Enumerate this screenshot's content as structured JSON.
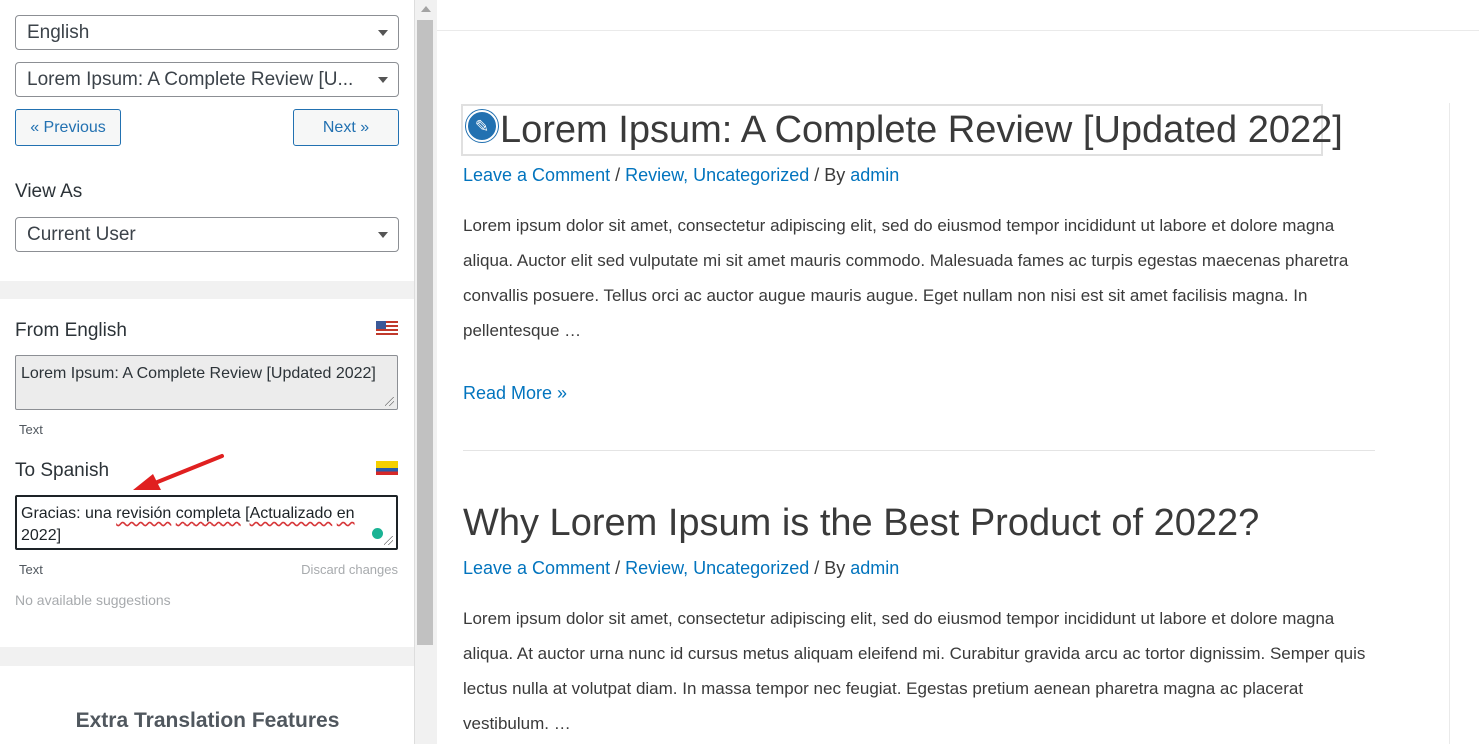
{
  "sidebar": {
    "language_select": "English",
    "string_select": "Lorem Ipsum: A Complete Review [U...",
    "prev_label": "« Previous",
    "next_label": "Next »",
    "view_as_label": "View As",
    "view_as_select": "Current User",
    "from_label": "From English",
    "from_text": "Lorem Ipsum: A Complete Review [Updated 2022]",
    "from_type": "Text",
    "to_label": "To Spanish",
    "to_text_part1": "Gracias: una ",
    "to_text_revision": "revisión",
    "to_text_space": " ",
    "to_text_completa": "completa",
    "to_text_part2": " [",
    "to_text_actualizado": "Actualizado",
    "to_text_part3": " ",
    "to_text_en": "en",
    "to_text_part4": " 2022]",
    "to_type": "Text",
    "discard_label": "Discard changes",
    "suggestions_text": "No available suggestions",
    "extra_title": "Extra Translation Features"
  },
  "posts": [
    {
      "title": "Lorem Ipsum: A Complete Review [Updated 2022]",
      "meta_comment": "Leave a Comment",
      "meta_sep1": " / ",
      "meta_cat1": "Review",
      "meta_comma": ", ",
      "meta_cat2": "Uncategorized",
      "meta_sep2": " / By ",
      "meta_author": "admin",
      "excerpt": "Lorem ipsum dolor sit amet, consectetur adipiscing elit, sed do eiusmod tempor incididunt ut labore et dolore magna aliqua. Auctor elit sed vulputate mi sit amet mauris commodo. Malesuada fames ac turpis egestas maecenas pharetra convallis posuere. Tellus orci ac auctor augue mauris augue. Eget nullam non nisi est sit amet facilisis magna. In pellentesque …",
      "read_more": "Read More »"
    },
    {
      "title": "Why Lorem Ipsum is the Best Product of 2022?",
      "meta_comment": "Leave a Comment",
      "meta_sep1": " / ",
      "meta_cat1": "Review",
      "meta_comma": ", ",
      "meta_cat2": "Uncategorized",
      "meta_sep2": " / By ",
      "meta_author": "admin",
      "excerpt": "Lorem ipsum dolor sit amet, consectetur adipiscing elit, sed do eiusmod tempor incididunt ut labore et dolore magna aliqua. At auctor urna nunc id cursus metus aliquam eleifend mi. Curabitur gravida arcu ac tortor dignissim. Semper quis lectus nulla at volutpat diam. In massa tempor nec feugiat. Egestas pretium aenean pharetra magna ac placerat vestibulum. …"
    }
  ],
  "icons": {
    "edit": "pencil-icon",
    "flag_from": "us-flag-icon",
    "flag_to": "colombia-flag-icon",
    "annotation": "red-arrow-annotation"
  },
  "colors": {
    "link": "#0274be",
    "button": "#2271b1",
    "spell_error": "#d63638",
    "arrow": "#e02020"
  }
}
